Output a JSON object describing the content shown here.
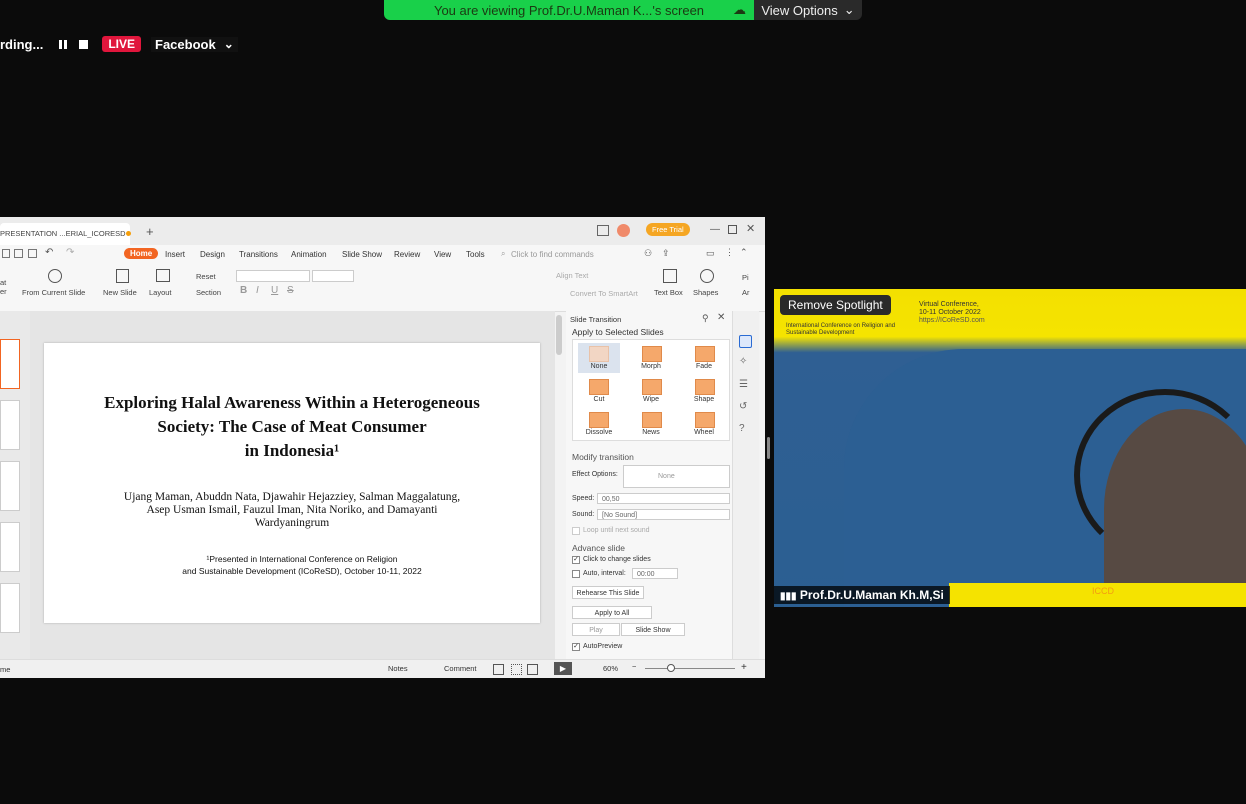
{
  "banner": {
    "viewing_text": "You are viewing Prof.Dr.U.Maman K...'s screen",
    "view_options": "View Options",
    "green": "#19d04a"
  },
  "recording": {
    "status_text": "rding...",
    "live_label": "LIVE",
    "destination": "Facebook"
  },
  "wps": {
    "doc_tab": "PRESENTATION ...ERIAL_ICORESD",
    "free_trial": "Free Trial",
    "menu_tabs": [
      "Home",
      "Insert",
      "Design",
      "Transitions",
      "Animation",
      "Slide Show",
      "Review",
      "View",
      "Tools"
    ],
    "search_placeholder": "Click to find commands",
    "ribbon": {
      "from_current_slide": "From Current Slide",
      "new_slide": "New Slide",
      "layout": "Layout",
      "reset": "Reset",
      "section": "Section",
      "align_text": "Align Text",
      "convert_smartart": "Convert To SmartArt",
      "text_box": "Text Box",
      "shapes": "Shapes",
      "left_cut_1": "at",
      "left_cut_2": "er",
      "right_cut_1": "Pi",
      "right_cut_2": "Ar"
    },
    "slide": {
      "title_line1": "Exploring Halal Awareness Within a Heterogeneous",
      "title_line2": "Society: The Case of Meat Consumer",
      "title_line3": "in Indonesia¹",
      "authors_line1": "Ujang Maman, Abuddn Nata, Djawahir Hejazziey, Salman Maggalatung,",
      "authors_line2": "Asep Usman Ismail, Fauzul Iman, Nita Noriko, and Damayanti",
      "authors_line3": "Wardyaningrum",
      "conf_line1": "¹Presented in International Conference on Religion",
      "conf_line2": "and Sustainable Development (ICoReSD), October 10-11, 2022"
    },
    "panel": {
      "header": "Slide Transition",
      "apply_selected": "Apply to Selected Slides",
      "transitions": [
        "None",
        "Morph",
        "Fade",
        "Cut",
        "Wipe",
        "Shape",
        "Dissolve",
        "News",
        "Wheel"
      ],
      "modify": "Modify transition",
      "effect_options_label": "Effect Options:",
      "effect_options_value": "None",
      "speed_label": "Speed:",
      "speed_value": "00,50",
      "sound_label": "Sound:",
      "sound_value": "[No Sound]",
      "loop_label": "Loop until next sound",
      "advance": "Advance slide",
      "click_change": "Click to change slides",
      "auto_interval": "Auto, interval:",
      "interval_value": "00:00",
      "rehearse": "Rehearse This Slide",
      "apply_all": "Apply to All",
      "play": "Play",
      "slide_show": "Slide Show",
      "autopreview": "AutoPreview"
    },
    "status": {
      "left_cut": "me",
      "notes": "Notes",
      "comment": "Comment",
      "zoom": "60%"
    }
  },
  "video": {
    "remove_spotlight": "Remove Spotlight",
    "participant": "Prof.Dr.U.Maman Kh.M,Si",
    "banner_line1": "Virtual Conference,",
    "banner_line2": "10-11 October 2022",
    "banner_url": "https://ICoReSD.com",
    "banner_sub1": "International Conference on Religion and",
    "banner_sub2": "Sustainable Development",
    "partner_text": "ICCD"
  }
}
